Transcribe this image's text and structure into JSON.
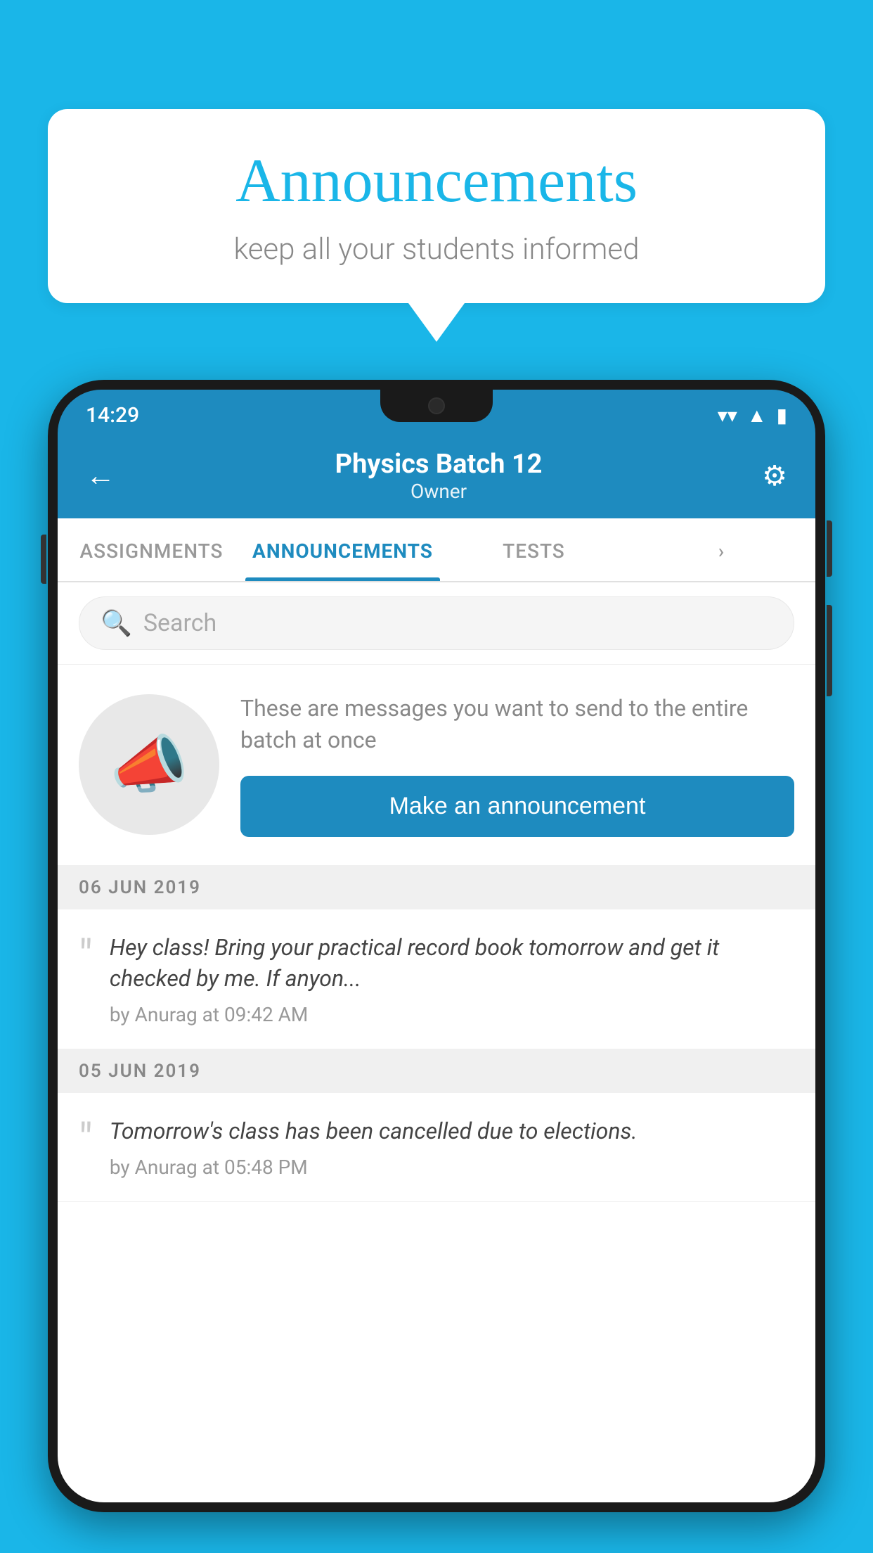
{
  "background_color": "#1ab6e8",
  "speech_bubble": {
    "title": "Announcements",
    "subtitle": "keep all your students informed"
  },
  "status_bar": {
    "time": "14:29",
    "wifi": "▼",
    "signal": "▲",
    "battery": "▮"
  },
  "header": {
    "title": "Physics Batch 12",
    "subtitle": "Owner",
    "back_label": "←",
    "settings_label": "⚙"
  },
  "tabs": [
    {
      "label": "ASSIGNMENTS",
      "active": false
    },
    {
      "label": "ANNOUNCEMENTS",
      "active": true
    },
    {
      "label": "TESTS",
      "active": false
    },
    {
      "label": "·",
      "active": false
    }
  ],
  "search": {
    "placeholder": "Search"
  },
  "promo": {
    "description": "These are messages you want to send to the entire batch at once",
    "button_label": "Make an announcement"
  },
  "announcements": [
    {
      "date": "06  JUN  2019",
      "text": "Hey class! Bring your practical record book tomorrow and get it checked by me. If anyon...",
      "meta": "by Anurag at 09:42 AM"
    },
    {
      "date": "05  JUN  2019",
      "text": "Tomorrow's class has been cancelled due to elections.",
      "meta": "by Anurag at 05:48 PM"
    }
  ]
}
